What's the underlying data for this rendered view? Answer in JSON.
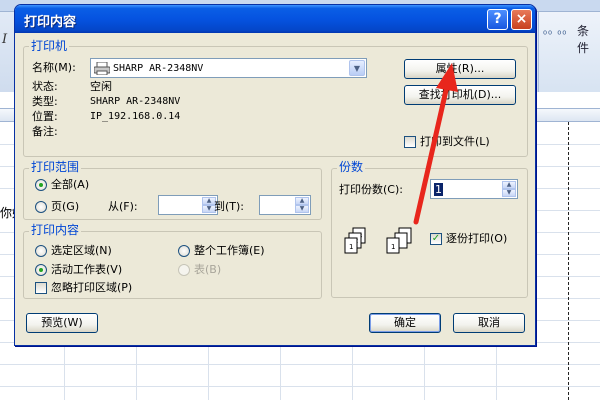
{
  "background": {
    "ribbon_italic": "I",
    "ribbon_right_label": "条件",
    "cell_text": "你好"
  },
  "dialog": {
    "title": "打印内容",
    "help_label": "?",
    "close_label": "×"
  },
  "printer": {
    "group_title": "打印机",
    "name_label": "名称(M):",
    "name_value": "SHARP AR-2348NV",
    "status_label": "状态:",
    "status_value": "空闲",
    "type_label": "类型:",
    "type_value": "SHARP AR-2348NV",
    "location_label": "位置:",
    "location_value": "IP_192.168.0.14",
    "comment_label": "备注:",
    "properties_button": "属性(R)...",
    "find_button": "查找打印机(D)...",
    "print_to_file_label": "打印到文件(L)"
  },
  "print_range": {
    "group_title": "打印范围",
    "all_label": "全部(A)",
    "pages_label": "页(G)",
    "from_label": "从(F):",
    "to_label": "到(T):",
    "from_value": "",
    "to_value": ""
  },
  "print_what": {
    "group_title": "打印内容",
    "selection_label": "选定区域(N)",
    "whole_workbook_label": "整个工作簿(E)",
    "active_sheet_label": "活动工作表(V)",
    "table_label": "表(B)",
    "ignore_area_label": "忽略打印区域(P)"
  },
  "copies": {
    "group_title": "份数",
    "count_label": "打印份数(C):",
    "count_value": "1",
    "collate_label": "逐份打印(O)"
  },
  "footer": {
    "preview_button": "预览(W)",
    "ok_button": "确定",
    "cancel_button": "取消"
  },
  "colors": {
    "annotation_arrow": "#e8261c",
    "titlebar": "#0553e0",
    "group_title": "#0046d5"
  }
}
